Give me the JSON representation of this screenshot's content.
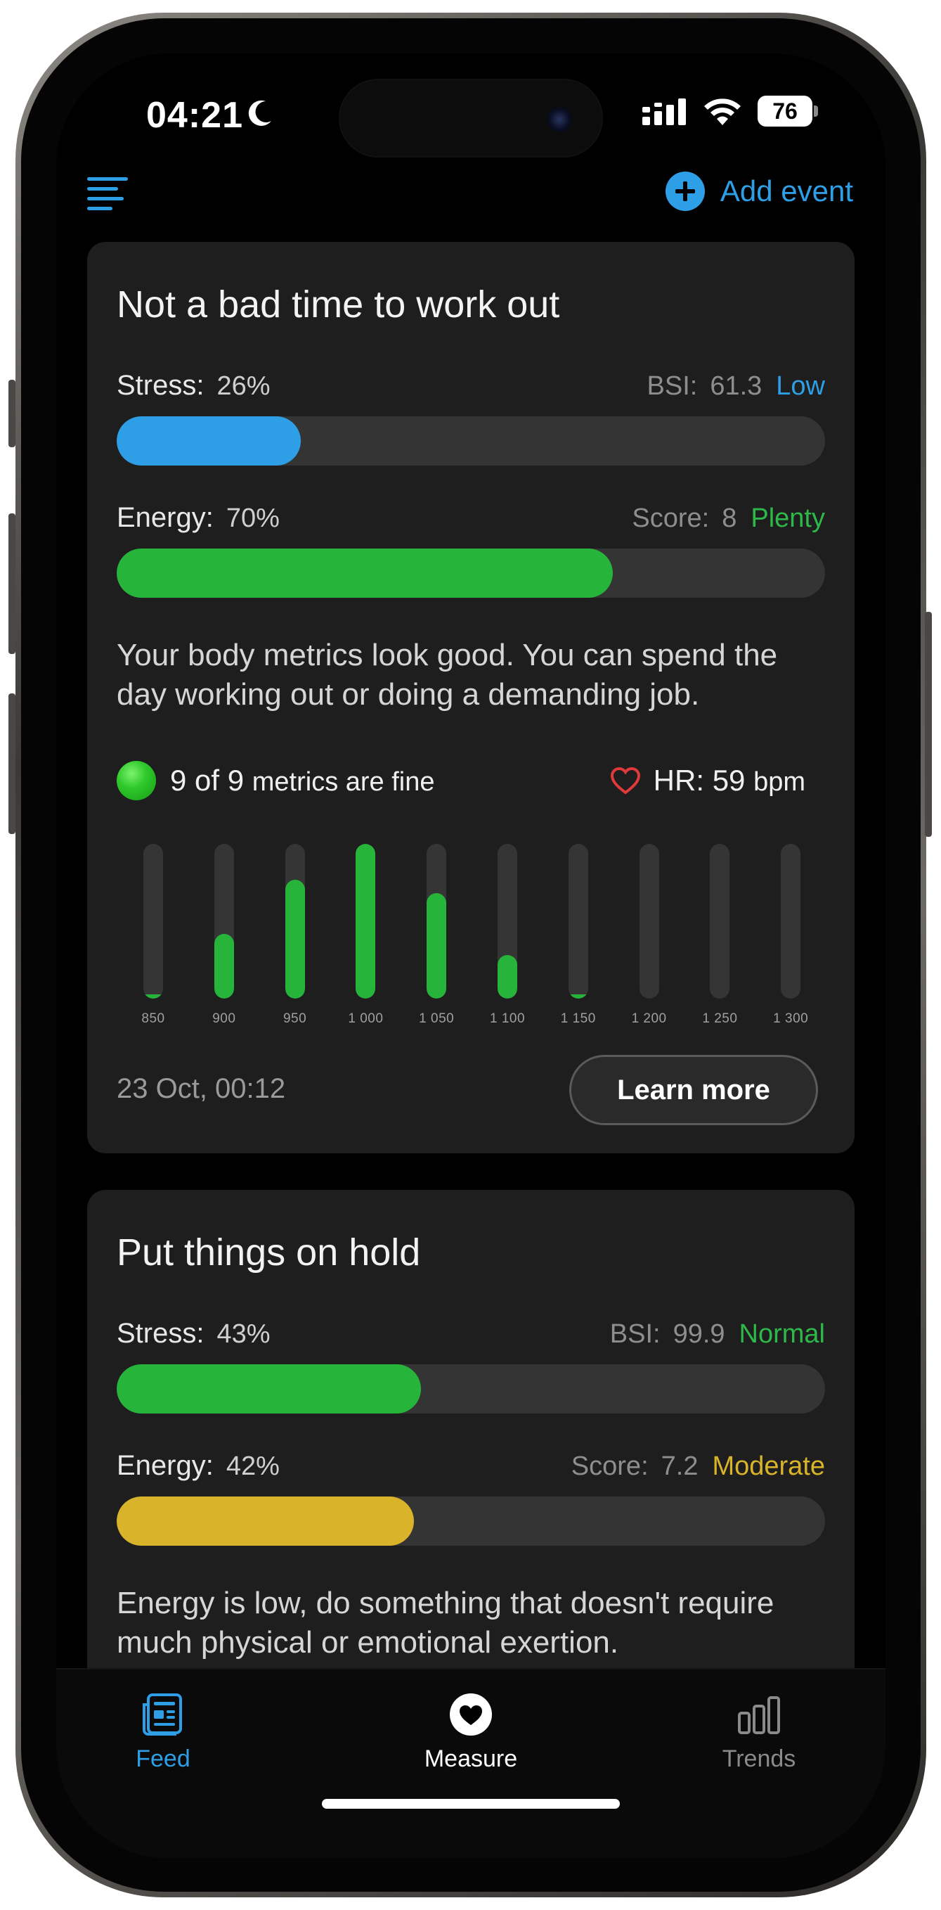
{
  "status_bar": {
    "time": "04:21",
    "battery": "76"
  },
  "header": {
    "add_event_label": "Add event"
  },
  "cards": [
    {
      "title": "Not a bad time to work out",
      "stress": {
        "label": "Stress:",
        "value": "26%",
        "fraction": 0.26,
        "index_label": "BSI:",
        "index_value": "61.3",
        "level": "Low",
        "level_color": "#2e9fe6",
        "bar_color": "#2e9fe6"
      },
      "energy": {
        "label": "Energy:",
        "value": "70%",
        "fraction": 0.7,
        "index_label": "Score:",
        "index_value": "8",
        "level": "Plenty",
        "level_color": "#2eb84a",
        "bar_color": "#27b43a"
      },
      "description": "Your body metrics look good. You can spend the day working out or doing a demanding job.",
      "metrics_summary": {
        "count": "9 of 9",
        "suffix": "metrics are fine"
      },
      "heart_rate": {
        "label": "HR:",
        "value": "59",
        "unit": "bpm"
      },
      "histogram": {
        "ticks": [
          "850",
          "900",
          "950",
          "1 000",
          "1 050",
          "1 100",
          "1 150",
          "1 200",
          "1 250",
          "1 300"
        ],
        "levels": [
          0.02,
          0.42,
          0.77,
          1.0,
          0.68,
          0.28,
          0.02,
          0,
          0,
          0
        ]
      },
      "timestamp": "23 Oct, 00:12",
      "learn_more_label": "Learn more"
    },
    {
      "title": "Put things on hold",
      "stress": {
        "label": "Stress:",
        "value": "43%",
        "fraction": 0.43,
        "index_label": "BSI:",
        "index_value": "99.9",
        "level": "Normal",
        "level_color": "#2eb84a",
        "bar_color": "#27b43a"
      },
      "energy": {
        "label": "Energy:",
        "value": "42%",
        "fraction": 0.42,
        "index_label": "Score:",
        "index_value": "7.2",
        "level": "Moderate",
        "level_color": "#d9b32a",
        "bar_color": "#d9b32a"
      },
      "description": "Energy is low, do something that doesn't require much physical or emotional exertion."
    }
  ],
  "tabbar": {
    "feed": "Feed",
    "measure": "Measure",
    "trends": "Trends"
  },
  "colors": {
    "accent": "#2e9fe6",
    "green": "#27b43a",
    "yellow": "#d9b32a",
    "card_bg": "#1e1e1e"
  },
  "icons": [
    "moon-icon",
    "signal-icon",
    "wifi-icon",
    "menu-icon",
    "plus-icon",
    "heart-icon",
    "feed-icon",
    "measure-heart-icon",
    "trends-icon"
  ]
}
